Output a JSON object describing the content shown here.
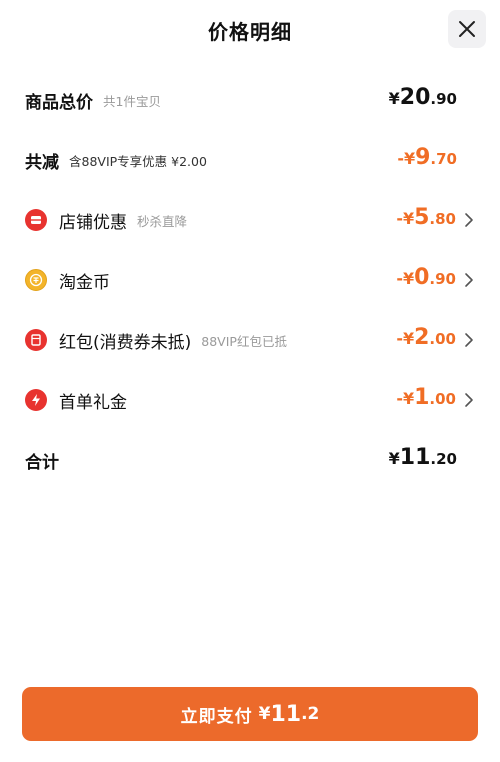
{
  "header": {
    "title": "价格明细",
    "close_icon": "close-icon"
  },
  "rows": [
    {
      "label": "商品总价",
      "sub": "共1件宝贝",
      "sign": "",
      "currency": "¥",
      "int": "20",
      "dec": ".90",
      "color": "black",
      "arrow": false
    },
    {
      "label": "共减",
      "sub": "含88VIP专享优惠 ¥2.00",
      "sign": "-",
      "currency": "¥",
      "int": "9",
      "dec": ".70",
      "color": "orange",
      "arrow": false
    },
    {
      "label": "店铺优惠",
      "sub": "秒杀直降",
      "sign": "-",
      "currency": "¥",
      "int": "5",
      "dec": ".80",
      "color": "orange",
      "arrow": true,
      "icon": "shop-coupon-icon"
    },
    {
      "label": "淘金币",
      "sub": "",
      "sign": "-",
      "currency": "¥",
      "int": "0",
      "dec": ".90",
      "color": "orange",
      "arrow": true,
      "icon": "gold-coin-icon"
    },
    {
      "label": "红包(消费券未抵)",
      "sub": "88VIP红包已抵",
      "sign": "-",
      "currency": "¥",
      "int": "2",
      "dec": ".00",
      "color": "orange",
      "arrow": true,
      "icon": "red-packet-icon"
    },
    {
      "label": "首单礼金",
      "sub": "",
      "sign": "-",
      "currency": "¥",
      "int": "1",
      "dec": ".00",
      "color": "orange",
      "arrow": true,
      "icon": "lightning-icon"
    },
    {
      "label": "合计",
      "sub": "",
      "sign": "",
      "currency": "¥",
      "int": "11",
      "dec": ".20",
      "color": "black",
      "arrow": false
    }
  ],
  "pay_button": {
    "label": "立即支付",
    "currency": "¥",
    "int": "11",
    "dec": ".2"
  },
  "colors": {
    "accent": "#ec6a2b",
    "amount_orange": "#f06d25",
    "icon_red": "#e8332f",
    "icon_gold": "#f3b42a"
  }
}
